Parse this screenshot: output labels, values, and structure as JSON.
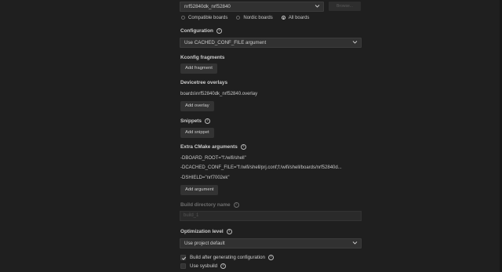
{
  "board": {
    "value": "nrf52840dk_nrf52840",
    "side_button_label": "Browse...",
    "filter_options": [
      {
        "label": "Compatible boards",
        "selected": false
      },
      {
        "label": "Nordic boards",
        "selected": false
      },
      {
        "label": "All boards",
        "selected": true
      }
    ]
  },
  "configuration": {
    "heading": "Configuration",
    "value": "Use CACHED_CONF_FILE argument"
  },
  "kconfig": {
    "heading": "Kconfig fragments",
    "button": "Add fragment"
  },
  "devicetree": {
    "heading": "Devicetree overlays",
    "items": [
      "boards\\nrf52840dk_nrf52840.overlay"
    ],
    "button": "Add overlay"
  },
  "snippets": {
    "heading": "Snippets",
    "button": "Add snippet"
  },
  "cmake": {
    "heading": "Extra CMake arguments",
    "args": [
      "-DBOARD_ROOT=\"f:/wifi/shell\"",
      "-DCACHED_CONF_FILE=\"f:/wifi/shell/prj.conf;f:/wifi/shell/boards/nrf52840d...",
      "-DSHIELD=\"nrf7002ek\""
    ],
    "button": "Add argument"
  },
  "build_dir": {
    "heading": "Build directory name",
    "value": "build_1"
  },
  "optimization": {
    "heading": "Optimization level",
    "value": "Use project default"
  },
  "checkboxes": [
    {
      "label": "Build after generating configuration",
      "checked": true,
      "help": true
    },
    {
      "label": "Use sysbuild",
      "checked": false,
      "help": true
    }
  ],
  "colors": {
    "background": "#1f1f1f",
    "field": "#313131",
    "button": "#333333",
    "text": "#cccccc",
    "disabled_text": "#6e6e6e"
  }
}
